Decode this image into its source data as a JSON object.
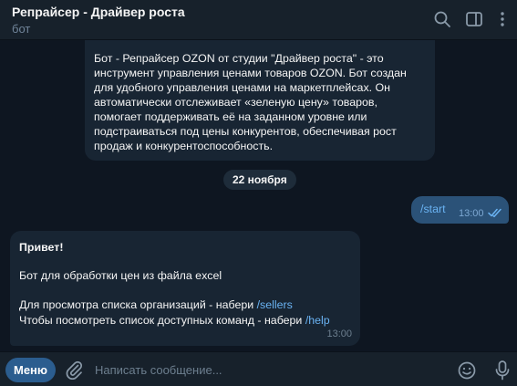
{
  "header": {
    "title": "Репрайсер - Драйвер роста",
    "subtitle": "бот",
    "icons": [
      "search-icon",
      "sidebar-toggle-icon",
      "more-vertical-icon"
    ]
  },
  "description": {
    "text": "Бот - Репрайсер OZON от студии \"Драйвер роста\" - это инструмент управления ценами товаров OZON. Бот создан для удобного управления ценами на маркетплейсах. Он автоматически отслеживает «зеленую цену» товаров, помогает поддерживать её на заданном уровне или подстраиваться под цены конкурентов, обеспечивая рост продаж и конкурентоспособность."
  },
  "date_separator": "22 ноября",
  "outgoing": {
    "text": "/start",
    "time": "13:00",
    "status_icon": "double-check-icon"
  },
  "reply": {
    "title": "Привет!",
    "line1": "Бот для обработки цен из файла excel",
    "line2_prefix": "Для просмотра списка организаций - набери ",
    "line2_cmd": "/sellers",
    "line3_prefix": "Чтобы посмотреть список доступных команд - набери ",
    "line3_cmd": "/help",
    "time": "13:00"
  },
  "composer": {
    "menu_label": "Меню",
    "placeholder": "Написать сообщение...",
    "icons": [
      "attach-icon",
      "emoji-icon",
      "microphone-icon"
    ]
  },
  "colors": {
    "background": "#0e1621",
    "header": "#17212b",
    "bubble_in": "#182533",
    "bubble_out": "#2b5278",
    "accent": "#6ab3f3",
    "menu_button": "#2b5d8f"
  }
}
